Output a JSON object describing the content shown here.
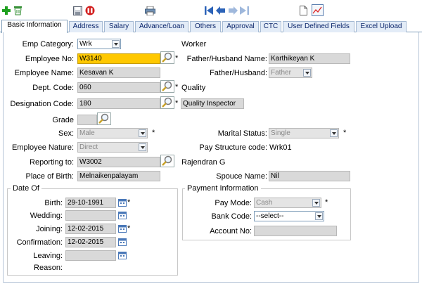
{
  "tabs": [
    {
      "label": "Basic Information",
      "active": true
    },
    {
      "label": "Address"
    },
    {
      "label": "Salary"
    },
    {
      "label": "Advance/Loan"
    },
    {
      "label": "Others"
    },
    {
      "label": "Approval"
    },
    {
      "label": "CTC"
    },
    {
      "label": "User Defined Fields"
    },
    {
      "label": "Excel Upload"
    }
  ],
  "form": {
    "emp_category": {
      "label": "Emp Category:",
      "value": "Wrk",
      "desc": "Worker"
    },
    "employee_no": {
      "label": "Employee No:",
      "value": "W3140"
    },
    "father_husband_name": {
      "label": "Father/Husband Name:",
      "value": "Karthikeyan K"
    },
    "employee_name": {
      "label": "Employee Name:",
      "value": "Kesavan K"
    },
    "father_husband": {
      "label": "Father/Husband:",
      "value": "Father"
    },
    "dept_code": {
      "label": "Dept. Code:",
      "value": "060",
      "desc": "Quality"
    },
    "designation_code": {
      "label": "Designation Code:",
      "value": "180",
      "desc": "Quality Inspector"
    },
    "grade": {
      "label": "Grade",
      "value": ""
    },
    "sex": {
      "label": "Sex:",
      "value": "Male"
    },
    "marital_status": {
      "label": "Marital Status:",
      "value": "Single"
    },
    "employee_nature": {
      "label": "Employee Nature:",
      "value": "Direct"
    },
    "pay_structure": {
      "label": "Pay Structure code:",
      "value": "Wrk01"
    },
    "reporting_to": {
      "label": "Reporting to:",
      "value": "W3002",
      "desc": "Rajendran G"
    },
    "place_of_birth": {
      "label": "Place of Birth:",
      "value": "Melnaikenpalayam"
    },
    "spouce_name": {
      "label": "Spouce Name:",
      "value": "Nil"
    }
  },
  "date_of": {
    "legend": "Date Of",
    "birth": {
      "label": "Birth:",
      "value": "29-10-1991"
    },
    "wedding": {
      "label": "Wedding:",
      "value": ""
    },
    "joining": {
      "label": "Joining:",
      "value": "12-02-2015"
    },
    "confirmation": {
      "label": "Confirmation:",
      "value": "12-02-2015"
    },
    "leaving": {
      "label": "Leaving:",
      "value": ""
    },
    "reason": {
      "label": "Reason:"
    }
  },
  "payment": {
    "legend": "Payment Information",
    "pay_mode": {
      "label": "Pay Mode:",
      "value": "Cash"
    },
    "bank_code": {
      "label": "Bank Code:",
      "value": "--select--"
    },
    "account_no": {
      "label": "Account No:",
      "value": ""
    }
  },
  "required_mark": "*",
  "colors": {
    "highlight": "#ffc800",
    "tab_bg": "#e3ecf7",
    "readonly_bg": "#d9d9d9"
  }
}
